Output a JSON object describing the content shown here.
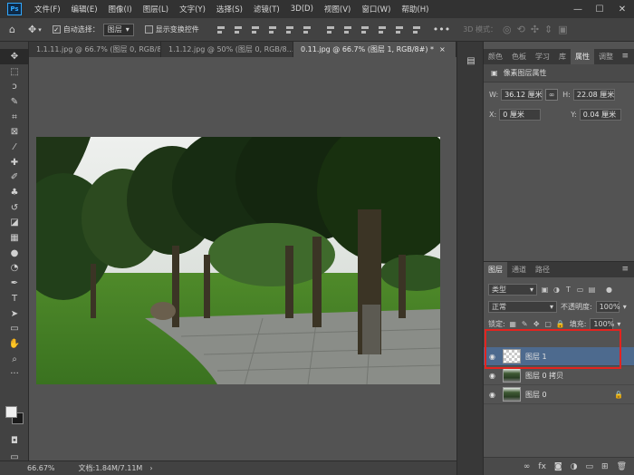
{
  "menubar": {
    "logo": "Ps",
    "items": [
      "文件(F)",
      "编辑(E)",
      "图像(I)",
      "图层(L)",
      "文字(Y)",
      "选择(S)",
      "滤镜(T)",
      "3D(D)",
      "视图(V)",
      "窗口(W)",
      "帮助(H)"
    ],
    "window_controls": [
      "—",
      "☐",
      "✕"
    ]
  },
  "options": {
    "auto_select_label": "自动选择：",
    "auto_select_checked": "✓",
    "target": "图层",
    "show_transform_label": "显示变换控件",
    "three_d_mode_label": "3D 模式："
  },
  "doc_tabs": [
    {
      "label": "1.1.11.jpg @ 66.7% (图层 0, RGB/8...",
      "close": "×"
    },
    {
      "label": "1.1.12.jpg @ 50% (图层 0, RGB/8...",
      "close": "×"
    },
    {
      "label": "0.11.jpg @ 66.7% (图层 1, RGB/8#) *",
      "close": "×"
    }
  ],
  "status": {
    "zoom": "66.67%",
    "doc_info": "文档:1.84M/7.11M",
    "arrow": "›"
  },
  "tools": [
    "move-tool",
    "marquee-tool",
    "lasso-tool",
    "quick-select-tool",
    "crop-tool",
    "frame-tool",
    "eyedropper-tool",
    "healing-tool",
    "brush-tool",
    "stamp-tool",
    "history-brush-tool",
    "eraser-tool",
    "gradient-tool",
    "blur-tool",
    "dodge-tool",
    "pen-tool",
    "type-tool",
    "path-select-tool",
    "rectangle-tool",
    "hand-tool",
    "zoom-tool",
    "more-tool"
  ],
  "properties_panel": {
    "tabs": [
      "颜色",
      "色板",
      "学习",
      "库",
      "属性",
      "调整"
    ],
    "active_tab": "属性",
    "section_title": "像素图层属性",
    "w_label": "W:",
    "w_value": "36.12 厘米",
    "h_label": "H:",
    "h_value": "22.08 厘米",
    "x_label": "X:",
    "x_value": "0 厘米",
    "y_label": "Y:",
    "y_value": "0.04 厘米"
  },
  "layers_panel": {
    "tabs": [
      "图层",
      "通道",
      "路径"
    ],
    "active_tab": "图层",
    "filter_kind": "类型",
    "blend_mode": "正常",
    "opacity_label": "不透明度:",
    "opacity_value": "100%",
    "lock_label": "锁定:",
    "fill_label": "填充:",
    "fill_value": "100%",
    "layers": [
      {
        "name": "图层 1",
        "selected": true,
        "thumb": "transparent"
      },
      {
        "name": "图层 0 拷贝",
        "selected": false,
        "thumb": "photo"
      },
      {
        "name": "图层 0",
        "selected": false,
        "thumb": "photo",
        "locked": true
      }
    ]
  },
  "colors": {
    "selected_layer": "#4d6a8e",
    "highlight": "#e3231f",
    "brand": "#31a8ff"
  }
}
